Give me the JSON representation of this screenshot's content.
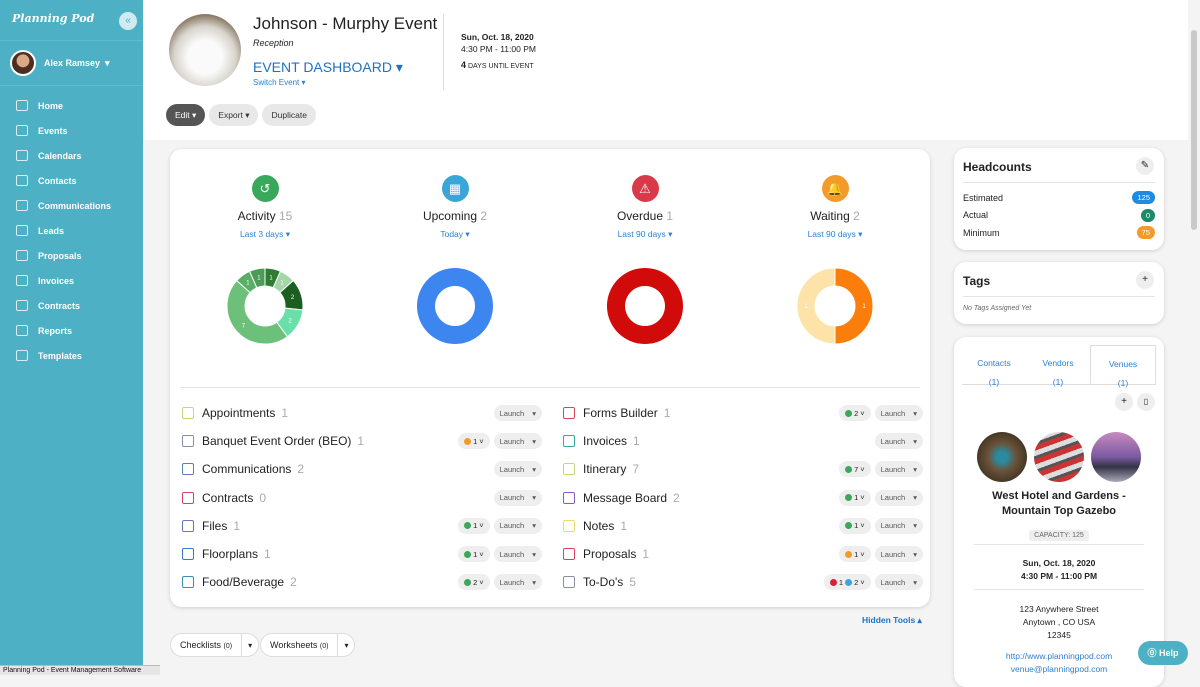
{
  "sidebar": {
    "logo": "Planning Pod",
    "user": "Alex Ramsey",
    "items": [
      {
        "label": "Home",
        "icon": "home-icon"
      },
      {
        "label": "Events",
        "icon": "events-icon"
      },
      {
        "label": "Calendars",
        "icon": "calendar-icon"
      },
      {
        "label": "Contacts",
        "icon": "contacts-icon"
      },
      {
        "label": "Communications",
        "icon": "communications-icon"
      },
      {
        "label": "Leads",
        "icon": "leads-icon"
      },
      {
        "label": "Proposals",
        "icon": "proposals-icon"
      },
      {
        "label": "Invoices",
        "icon": "invoices-icon"
      },
      {
        "label": "Contracts",
        "icon": "contracts-icon"
      },
      {
        "label": "Reports",
        "icon": "reports-icon"
      },
      {
        "label": "Templates",
        "icon": "templates-icon"
      }
    ]
  },
  "statusbar": "Planning Pod - Event Management Software",
  "header": {
    "title": "Johnson - Murphy Event",
    "subtitle": "Reception",
    "dashboard": "EVENT DASHBOARD ▾",
    "switch": "Switch Event ▾",
    "date": "Sun, Oct. 18, 2020",
    "time": "4:30 PM - 11:00 PM",
    "days": "4",
    "days_label": "DAYS UNTIL EVENT"
  },
  "toolbar": {
    "edit": "Edit ▾",
    "export": "Export ▾",
    "duplicate": "Duplicate"
  },
  "stats": [
    {
      "label": "Activity",
      "count": "15",
      "range": "Last 3 days ▾",
      "color": "#3aa85a",
      "icon": "history-icon",
      "glyph": "↺",
      "segments": [
        1,
        1,
        2,
        2,
        7,
        1,
        1
      ],
      "colors": [
        "#2e7d32",
        "#a5d6a7",
        "#1b5e20",
        "#69e0a8",
        "#6cc07a",
        "#5aae66",
        "#4c9c58"
      ]
    },
    {
      "label": "Upcoming",
      "count": "2",
      "range": "Today ▾",
      "color": "#3aa6d8",
      "icon": "calendar-icon",
      "glyph": "▦",
      "segments": [
        2
      ],
      "colors": [
        "#3d86f0"
      ]
    },
    {
      "label": "Overdue",
      "count": "1",
      "range": "Last 90 days ▾",
      "color": "#d93a4a",
      "icon": "warning-icon",
      "glyph": "⚠",
      "segments": [
        1
      ],
      "colors": [
        "#d10a0a"
      ]
    },
    {
      "label": "Waiting",
      "count": "2",
      "range": "Last 90 days ▾",
      "color": "#f39a2a",
      "icon": "bell-icon",
      "glyph": "🔔",
      "segments": [
        1,
        1
      ],
      "colors": [
        "#fb7d0c",
        "#fde3a7"
      ]
    }
  ],
  "tools_left": [
    {
      "name": "Appointments",
      "count": "1",
      "color": "#c6d67a",
      "badges": []
    },
    {
      "name": "Banquet Event Order (BEO)",
      "count": "1",
      "color": "#8a8fa6",
      "badges": [
        {
          "color": "#f39a2a",
          "n": "1"
        }
      ]
    },
    {
      "name": "Communications",
      "count": "2",
      "color": "#5b7fc0",
      "badges": []
    },
    {
      "name": "Contracts",
      "count": "0",
      "color": "#d8435d",
      "badges": []
    },
    {
      "name": "Files",
      "count": "1",
      "color": "#6a76c8",
      "badges": [
        {
          "color": "#3aa85a",
          "n": "1"
        }
      ]
    },
    {
      "name": "Floorplans",
      "count": "1",
      "color": "#3a7bd0",
      "badges": [
        {
          "color": "#3aa85a",
          "n": "1"
        }
      ]
    },
    {
      "name": "Food/Beverage",
      "count": "2",
      "color": "#3a8fc0",
      "badges": [
        {
          "color": "#3aa85a",
          "n": "2"
        }
      ]
    }
  ],
  "tools_right": [
    {
      "name": "Forms Builder",
      "count": "1",
      "color": "#d8435d",
      "badges": [
        {
          "color": "#3aa85a",
          "n": "2"
        }
      ]
    },
    {
      "name": "Invoices",
      "count": "1",
      "color": "#3aa6a0",
      "badges": []
    },
    {
      "name": "Itinerary",
      "count": "7",
      "color": "#c6d67a",
      "badges": [
        {
          "color": "#3aa85a",
          "n": "7"
        }
      ]
    },
    {
      "name": "Message Board",
      "count": "2",
      "color": "#8a5cc0",
      "badges": [
        {
          "color": "#3aa85a",
          "n": "1"
        }
      ]
    },
    {
      "name": "Notes",
      "count": "1",
      "color": "#f5d86a",
      "badges": [
        {
          "color": "#3aa85a",
          "n": "1"
        }
      ]
    },
    {
      "name": "Proposals",
      "count": "1",
      "color": "#d8435d",
      "badges": [
        {
          "color": "#f39a2a",
          "n": "1"
        }
      ]
    },
    {
      "name": "To-Do's",
      "count": "5",
      "color": "#8a8fa6",
      "badges": [
        {
          "color": "#d8203a",
          "n": "1"
        },
        {
          "color": "#3aa6d8",
          "n": "2"
        }
      ]
    }
  ],
  "launch": "Launch",
  "hidden_tools": "Hidden Tools ▴",
  "checklists": {
    "label": "Checklists",
    "count": "(0)"
  },
  "worksheets": {
    "label": "Worksheets",
    "count": "(0)"
  },
  "headcounts": {
    "title": "Headcounts",
    "rows": [
      {
        "label": "Estimated",
        "value": "125",
        "color": "#1f8ae0"
      },
      {
        "label": "Actual",
        "value": "0",
        "color": "#1a8a6a"
      },
      {
        "label": "Minimum",
        "value": "75",
        "color": "#f39a2a"
      }
    ]
  },
  "tags": {
    "title": "Tags",
    "empty": "No Tags Assigned Yet"
  },
  "venue_tabs": [
    {
      "label": "Contacts",
      "count": "(1)"
    },
    {
      "label": "Vendors",
      "count": "(1)"
    },
    {
      "label": "Venues",
      "count": "(1)"
    }
  ],
  "venue": {
    "name": "West Hotel and Gardens - Mountain Top Gazebo",
    "capacity": "CAPACITY: 125",
    "date": "Sun, Oct. 18, 2020",
    "time": "4:30 PM - 11:00 PM",
    "street": "123 Anywhere Street",
    "city": "Anytown , CO USA",
    "zip": "12345",
    "url": "http://www.planningpod.com",
    "email": "venue@planningpod.com"
  },
  "help": "⓪ Help"
}
